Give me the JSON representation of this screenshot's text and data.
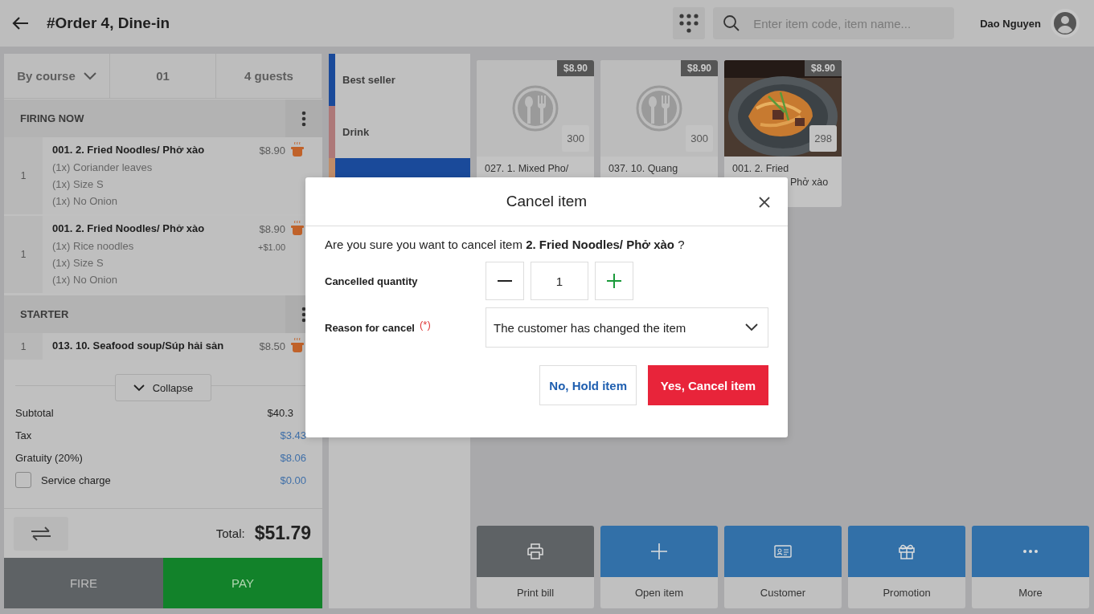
{
  "header": {
    "title": "#Order 4, Dine-in",
    "search": {
      "placeholder": "Enter item code, item name..."
    },
    "user_name": "Dao Nguyen"
  },
  "order_tabs": [
    {
      "label": "By course",
      "kind": "dropdown"
    },
    {
      "label": "01",
      "kind": "plain"
    },
    {
      "label": "4 guests",
      "kind": "plain"
    }
  ],
  "courses": [
    {
      "name": "FIRING NOW",
      "items": [
        {
          "qty": "1",
          "name": "001. 2. Fried Noodles/ Phở xào",
          "price": "$8.90",
          "modifiers": [
            "(1x) Coriander leaves",
            "(1x) Size S",
            "(1x) No Onion"
          ]
        },
        {
          "qty": "1",
          "name": "001. 2. Fried Noodles/ Phở xào",
          "price": "$8.90",
          "price_extra": "+$1.00",
          "modifiers": [
            "(1x) Rice noodles",
            "(1x) Size S",
            "(1x) No Onion"
          ]
        }
      ]
    },
    {
      "name": "STARTER",
      "items": [
        {
          "qty": "1",
          "name": "013. 10. Seafood soup/Súp hải sản",
          "price": "$8.50"
        }
      ]
    }
  ],
  "collapse_button": "Collapse",
  "summary": [
    {
      "label": "Subtotal",
      "value": "$40.3",
      "kind": "plain"
    },
    {
      "label": "Tax",
      "value": "$3.43",
      "kind": "link"
    },
    {
      "label": "Gratuity (20%)",
      "value": "$8.06",
      "kind": "link"
    },
    {
      "label": "Service charge",
      "value": "$0.00",
      "kind": "checkbox",
      "checked": false
    }
  ],
  "total": {
    "label": "Total:",
    "value": "$51.79"
  },
  "footer_buttons": [
    {
      "label": "FIRE",
      "kind": "fire"
    },
    {
      "label": "PAY",
      "kind": "pay"
    }
  ],
  "categories": [
    {
      "label": "Best seller",
      "color": "#1a4a9a",
      "selected": false
    },
    {
      "label": "Drink",
      "color": "#ad7878",
      "selected": false
    },
    {
      "color": "#c08c68",
      "selected": true
    }
  ],
  "menu_items": [
    {
      "price": "$8.90",
      "stock": "300",
      "name": [
        "027. 1. Mixed Pho/"
      ],
      "kind": "placeholder"
    },
    {
      "price": "$8.90",
      "stock": "300",
      "name": [
        "037. 10. Quang"
      ],
      "kind": "placeholder"
    },
    {
      "price": "$8.90",
      "stock": "298",
      "name": [
        "001. 2. Fried",
        "Phở xào"
      ],
      "kind": "picture"
    }
  ],
  "actions": [
    {
      "label": "Print bill",
      "kind": "print"
    },
    {
      "label": "Open item",
      "kind": "plus"
    },
    {
      "label": "Customer",
      "kind": "card"
    },
    {
      "label": "Promotion",
      "kind": "gift"
    },
    {
      "label": "More",
      "kind": "more"
    }
  ],
  "dialog": {
    "title": "Cancel item",
    "question": "Are you sure you want to cancel item **2. Fried Noodles/ Phở xào** ?",
    "quantity_label": "Cancelled quantity",
    "quantity": "1",
    "reason_label": "Reason for cancel",
    "required_mark": "(*)",
    "reason": "The customer has changed the item",
    "buttons": [
      {
        "label": "No, Hold item",
        "kind": "secondary"
      },
      {
        "label": "Yes, Cancel item",
        "kind": "danger"
      }
    ]
  }
}
